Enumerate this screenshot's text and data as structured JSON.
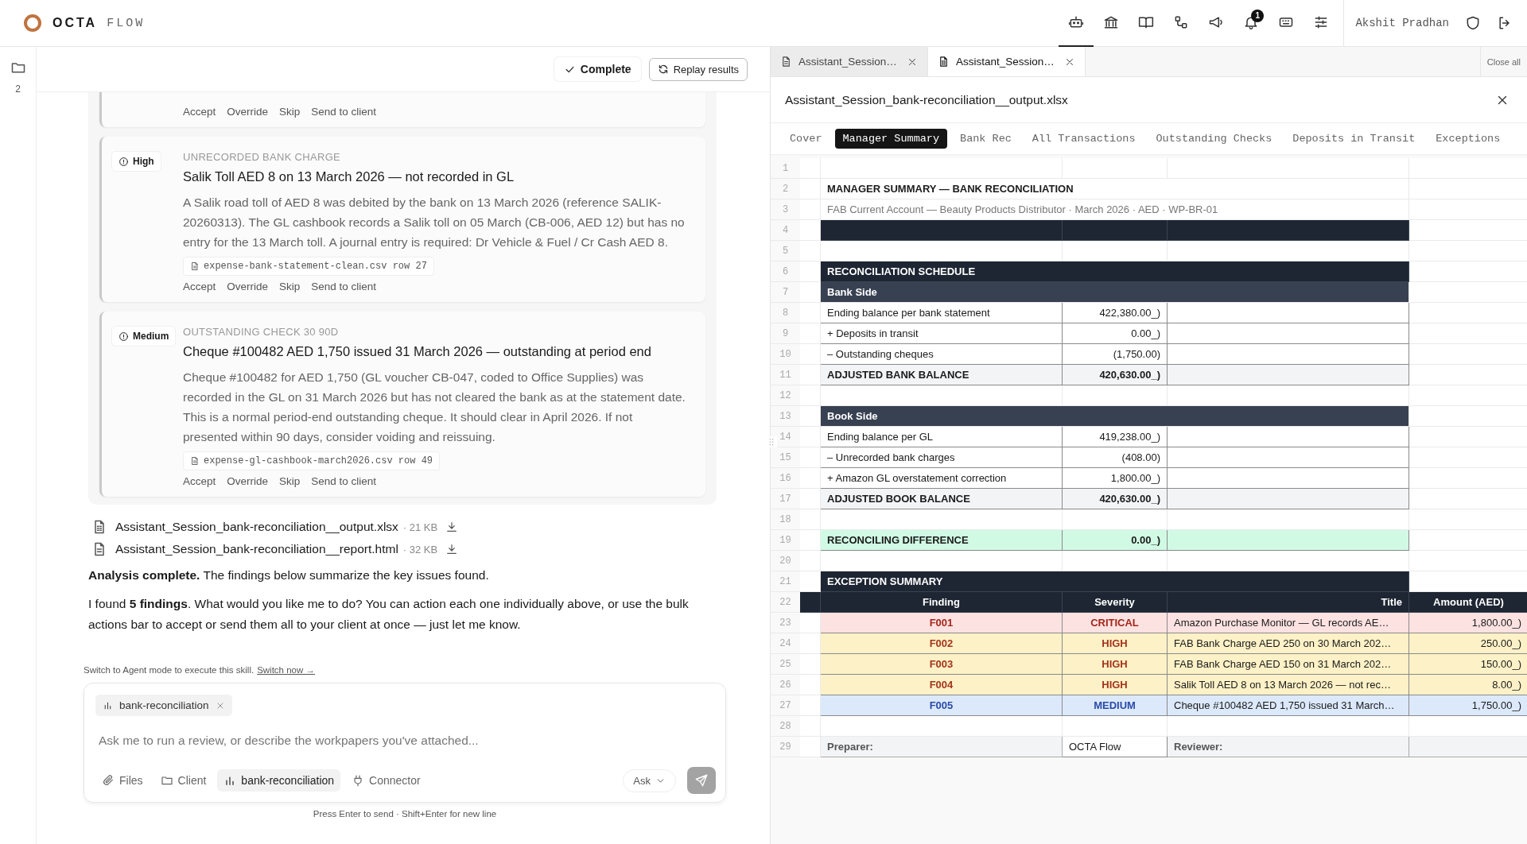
{
  "brand": {
    "name": "OCTA",
    "suffix": "FLOW"
  },
  "header": {
    "icons": [
      {
        "kind": "bot",
        "selected": true
      },
      {
        "kind": "bank",
        "selected": false
      },
      {
        "kind": "book",
        "selected": false
      },
      {
        "kind": "flow",
        "selected": false
      },
      {
        "kind": "megaphone",
        "selected": false
      },
      {
        "kind": "bell",
        "selected": false,
        "badge": "1"
      },
      {
        "kind": "keyboard",
        "selected": false
      },
      {
        "kind": "sliders",
        "selected": false
      }
    ],
    "user": "Akshit Pradhan"
  },
  "rail": {
    "count": "2"
  },
  "chat": {
    "status": "Complete",
    "replay": "Replay results",
    "findings": [
      {
        "kind": "cut",
        "actions": [
          "Accept",
          "Override",
          "Skip",
          "Send to client"
        ]
      },
      {
        "kind": "full",
        "severity": "High",
        "category": "UNRECORDED BANK CHARGE",
        "title": "Salik Toll AED 8 on 13 March 2026 — not recorded in GL",
        "body": "A Salik road toll of AED 8 was debited by the bank on 13 March 2026 (reference SALIK-20260313). The GL cashbook records a Salik toll on 05 March (CB-006, AED 12) but has no entry for the 13 March toll. A journal entry is required: Dr Vehicle & Fuel / Cr Cash AED 8.",
        "source": "expense-bank-statement-clean.csv row 27",
        "actions": [
          "Accept",
          "Override",
          "Skip",
          "Send to client"
        ]
      },
      {
        "kind": "full",
        "severity": "Medium",
        "category": "OUTSTANDING CHECK 30 90D",
        "title": "Cheque #100482 AED 1,750 issued 31 March 2026 — outstanding at period end",
        "body": "Cheque #100482 for AED 1,750 (GL voucher CB-047, coded to Office Supplies) was recorded in the GL on 31 March 2026 but has not cleared the bank as at the statement date. This is a normal period-end outstanding cheque. It should clear in April 2026. If not presented within 90 days, consider voiding and reissuing.",
        "source": "expense-gl-cashbook-march2026.csv row 49",
        "actions": [
          "Accept",
          "Override",
          "Skip",
          "Send to client"
        ]
      }
    ],
    "files": [
      {
        "kind": "sheet",
        "name": "Assistant_Session_bank-reconciliation__output.xlsx",
        "size": "· 21 KB"
      },
      {
        "kind": "doc",
        "name": "Assistant_Session_bank-reconciliation__report.html",
        "size": "· 32 KB"
      }
    ],
    "messages": [
      "**Analysis complete.** The findings below summarize the key issues found.",
      "I found **5 findings**. What would you like me to do? You can action each one individually above, or use the bulk actions bar to accept or send them all to your client at once — just let me know."
    ],
    "notice": {
      "text": "Switch to Agent mode to execute this skill.",
      "link": "Switch now →"
    },
    "composer": {
      "chip": "bank-reconciliation",
      "placeholder": "Ask me to run a review, or describe the workpapers you've attached...",
      "tools": [
        {
          "kind": "files",
          "label": "Files",
          "selected": false
        },
        {
          "kind": "client",
          "label": "Client",
          "selected": false
        },
        {
          "kind": "skill",
          "label": "bank-reconciliation",
          "selected": true
        },
        {
          "kind": "connector",
          "label": "Connector",
          "selected": false
        }
      ],
      "mode": "Ask",
      "hint": "Press Enter to send · Shift+Enter for new line"
    }
  },
  "viewer": {
    "file_tabs": [
      {
        "kind": "doc",
        "label": "Assistant_Session…",
        "selected": false
      },
      {
        "kind": "sheet",
        "label": "Assistant_Session…",
        "selected": true
      }
    ],
    "close_all": "Close all",
    "title": "Assistant_Session_bank-reconciliation__output.xlsx",
    "sheet_tabs": [
      {
        "label": "Cover",
        "selected": false
      },
      {
        "label": "Manager Summary",
        "selected": true
      },
      {
        "label": "Bank Rec",
        "selected": false
      },
      {
        "label": "All Transactions",
        "selected": false
      },
      {
        "label": "Outstanding Checks",
        "selected": false
      },
      {
        "label": "Deposits in Transit",
        "selected": false
      },
      {
        "label": "Exceptions",
        "selected": false
      }
    ],
    "rows": [
      {
        "n": "1",
        "kind": "blank"
      },
      {
        "n": "2",
        "kind": "title",
        "text": "MANAGER SUMMARY — BANK RECONCILIATION"
      },
      {
        "n": "3",
        "kind": "subtitle",
        "text": "FAB Current Account — Beauty Products Distributor · March 2026 · AED · WP-BR-01"
      },
      {
        "n": "4",
        "kind": "band"
      },
      {
        "n": "5",
        "kind": "blank"
      },
      {
        "n": "6",
        "kind": "section",
        "text": "RECONCILIATION SCHEDULE"
      },
      {
        "n": "7",
        "kind": "subsection",
        "text": "Bank Side"
      },
      {
        "n": "8",
        "kind": "line",
        "label": "Ending balance per bank statement",
        "value": "422,380.00_)"
      },
      {
        "n": "9",
        "kind": "line",
        "label": "+ Deposits in transit",
        "value": "0.00_)"
      },
      {
        "n": "10",
        "kind": "line",
        "label": "– Outstanding cheques",
        "value": "(1,750.00)"
      },
      {
        "n": "11",
        "kind": "total",
        "label": "ADJUSTED BANK BALANCE",
        "value": "420,630.00_)"
      },
      {
        "n": "12",
        "kind": "blank"
      },
      {
        "n": "13",
        "kind": "subsection",
        "text": "Book Side"
      },
      {
        "n": "14",
        "kind": "line",
        "label": "Ending balance per GL",
        "value": "419,238.00_)"
      },
      {
        "n": "15",
        "kind": "line",
        "label": "– Unrecorded bank charges",
        "value": "(408.00)"
      },
      {
        "n": "16",
        "kind": "line",
        "label": "+ Amazon GL overstatement correction",
        "value": "1,800.00_)"
      },
      {
        "n": "17",
        "kind": "total",
        "label": "ADJUSTED BOOK BALANCE",
        "value": "420,630.00_)"
      },
      {
        "n": "18",
        "kind": "blank"
      },
      {
        "n": "19",
        "kind": "difference",
        "label": "RECONCILING DIFFERENCE",
        "value": "0.00_)"
      },
      {
        "n": "20",
        "kind": "blank"
      },
      {
        "n": "21",
        "kind": "section",
        "text": "EXCEPTION SUMMARY"
      },
      {
        "n": "22",
        "kind": "colheader",
        "cells": [
          "Finding",
          "Severity",
          "Title",
          "Amount (AED)"
        ]
      },
      {
        "n": "23",
        "kind": "exception",
        "color": "#fde2e2",
        "id": "F001",
        "severity": "CRITICAL",
        "title": "Amazon Purchase Monitor — GL records AE…",
        "amount": "1,800.00_)"
      },
      {
        "n": "24",
        "kind": "exception",
        "color": "#fdf1c7",
        "id": "F002",
        "severity": "HIGH",
        "title": "FAB Bank Charge AED 250 on 30 March 202…",
        "amount": "250.00_)"
      },
      {
        "n": "25",
        "kind": "exception",
        "color": "#fdf1c7",
        "id": "F003",
        "severity": "HIGH",
        "title": "FAB Bank Charge AED 150 on 31 March 202…",
        "amount": "150.00_)"
      },
      {
        "n": "26",
        "kind": "exception",
        "color": "#fdf1c7",
        "id": "F004",
        "severity": "HIGH",
        "title": "Salik Toll AED 8 on 13 March 2026 — not rec…",
        "amount": "8.00_)"
      },
      {
        "n": "27",
        "kind": "exception",
        "color": "#dce9fb",
        "id": "F005",
        "severity": "MEDIUM",
        "title": "Cheque #100482 AED 1,750 issued 31 March…",
        "amount": "1,750.00_)"
      },
      {
        "n": "28",
        "kind": "blank"
      },
      {
        "n": "29",
        "kind": "footer",
        "cells": [
          "Preparer:",
          "OCTA Flow",
          "Reviewer:"
        ]
      }
    ]
  }
}
